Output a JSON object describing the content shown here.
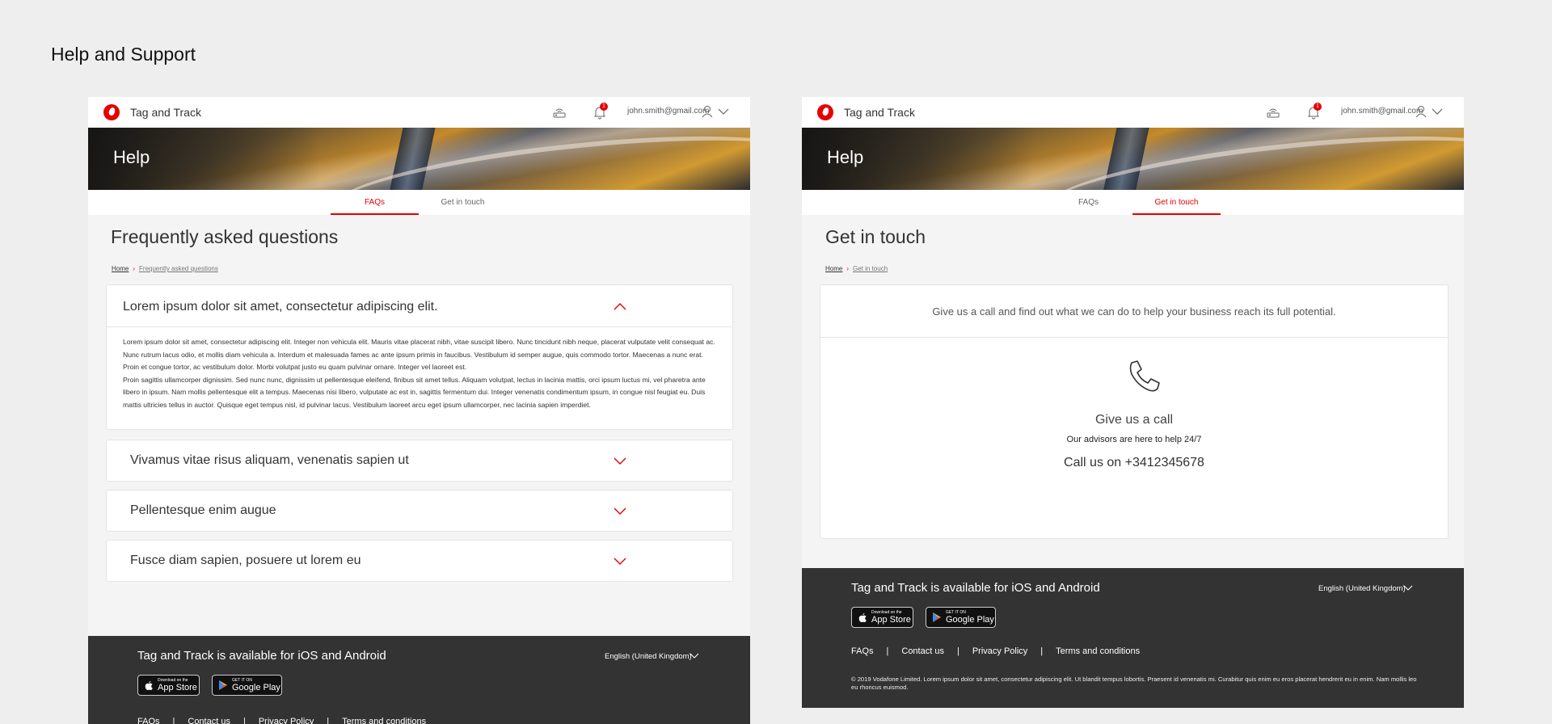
{
  "page_title": "Help and Support",
  "header": {
    "brand": "Tag and Track",
    "notification_count": "1",
    "user_email": "john.smith@gmail.com"
  },
  "hero": {
    "title": "Help"
  },
  "tabs": {
    "faqs": "FAQs",
    "get_in_touch": "Get in touch"
  },
  "faq_screen": {
    "title": "Frequently asked questions",
    "breadcrumb": {
      "home": "Home",
      "current": "Frequently asked questions"
    },
    "items": [
      {
        "question": "Lorem ipsum dolor sit amet, consectetur adipiscing elit.",
        "expanded": true,
        "answer_p1": "Lorem ipsum dolor sit amet, consectetur adipiscing elit. Integer non vehicula elit. Mauris vitae placerat nibh, vitae suscipit libero. Nunc tincidunt nibh neque, placerat vulputate velit consequat ac. Nunc rutrum lacus odio, et mollis diam vehicula a. Interdum et malesuada fames ac ante ipsum primis in faucibus. Vestibulum id semper augue, quis commodo tortor. Maecenas a nunc erat. Proin et congue tortor, ac vestibulum dolor. Morbi volutpat justo eu quam pulvinar ornare. Integer vel laoreet est.",
        "answer_p2": "Proin sagittis ullamcorper dignissim. Sed nunc nunc, dignissim ut pellentesque eleifend, finibus sit amet tellus. Aliquam volutpat, lectus in lacinia mattis, orci ipsum luctus mi, vel pharetra ante libero in ipsum. Nam mollis pellentesque elit a tempus. Maecenas nisi libero, vulputate ac est in, sagittis fermentum dui. Integer venenatis condimentum ipsum, in congue nisl feugiat eu. Duis mattis ultricies tellus in auctor. Quisque eget tempus nisl, id pulvinar lacus. Vestibulum laoreet arcu eget ipsum ullamcorper, nec lacinia sapien imperdiet."
      },
      {
        "question": "Vivamus vitae risus aliquam, venenatis sapien ut",
        "expanded": false
      },
      {
        "question": "Pellentesque enim augue",
        "expanded": false
      },
      {
        "question": "Fusce diam sapien, posuere ut lorem eu",
        "expanded": false
      }
    ]
  },
  "contact_screen": {
    "title": "Get in touch",
    "breadcrumb": {
      "home": "Home",
      "current": "Get in touch"
    },
    "intro": "Give us a call and find out what we can do to help your business reach its full potential.",
    "call_title": "Give us a call",
    "call_subtitle": "Our advisors are here to help 24/7",
    "call_number": "Call us on +3412345678"
  },
  "footer": {
    "availability": "Tag and Track is available for iOS and Android",
    "language": "English (United Kingdom)",
    "app_store": {
      "small": "Download on the",
      "big": "App Store"
    },
    "google_play": {
      "small": "GET IT ON",
      "big": "Google Play"
    },
    "links": [
      "FAQs",
      "Contact us",
      "Privacy Policy",
      "Terms and conditions"
    ],
    "copyright": "© 2019 Vodafone Limited. Lorem ipsum dolor sit amet, consectetur adipiscing elit. Ut blandit tempus lobortis. Praesent id venenatis mi. Curabitur quis enim eu eros placerat hendrerit eu in enim. Nam mollis leo eu rhoncus euismod."
  },
  "colors": {
    "accent": "#e60000",
    "footer_bg": "#333333",
    "page_bg": "#eeeeee"
  }
}
